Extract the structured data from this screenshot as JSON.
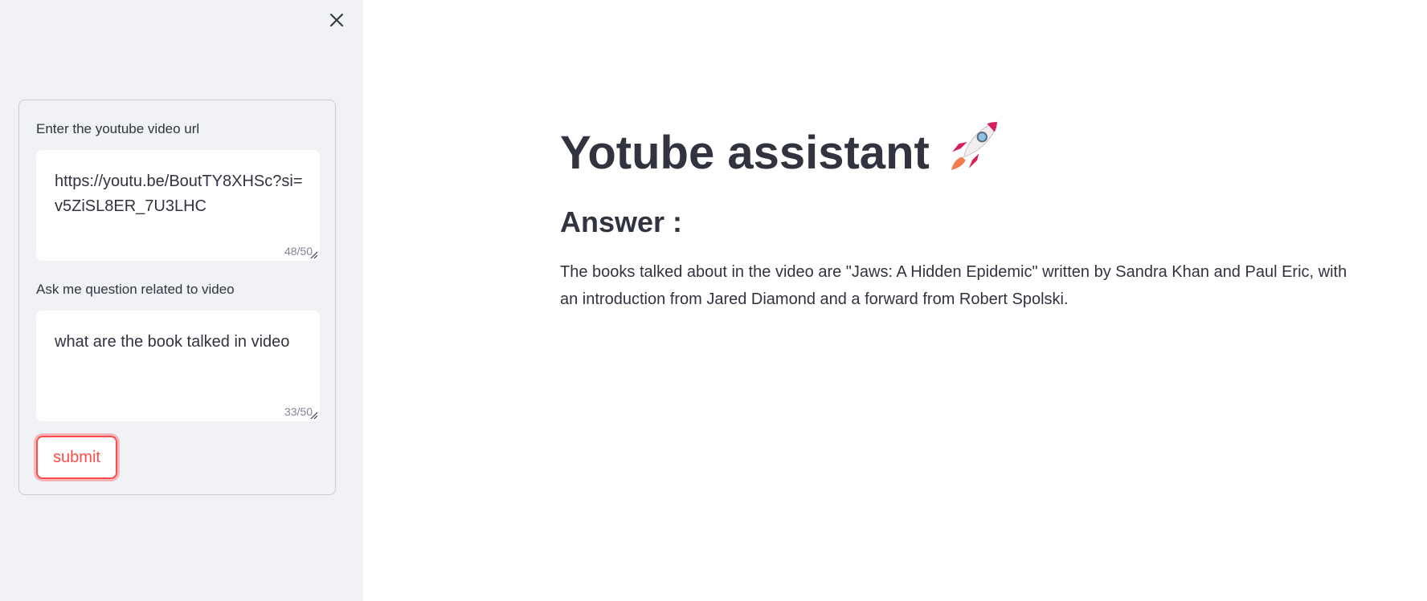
{
  "sidebar": {
    "close_icon": "close-icon",
    "url_field": {
      "label": "Enter the youtube video url",
      "value": "https://youtu.be/BoutTY8XHSc?si=v5ZiSL8ER_7U3LHC",
      "counter": "48/50"
    },
    "question_field": {
      "label": "Ask me question related to video",
      "value": "what are the book talked in video",
      "counter": "33/50"
    },
    "submit_label": "submit"
  },
  "main": {
    "title": "Yotube assistant",
    "title_icon": "rocket-icon",
    "answer_heading": "Answer :",
    "answer_text": "The books talked about in the video are \"Jaws: A Hidden Epidemic\" written by Sandra Khan and Paul Eric, with an introduction from Jared Diamond and a forward from Robert Spolski."
  },
  "colors": {
    "sidebar_bg": "#f0f2f6",
    "text": "#31333f",
    "accent": "#ff4b4b",
    "muted": "#808495"
  }
}
